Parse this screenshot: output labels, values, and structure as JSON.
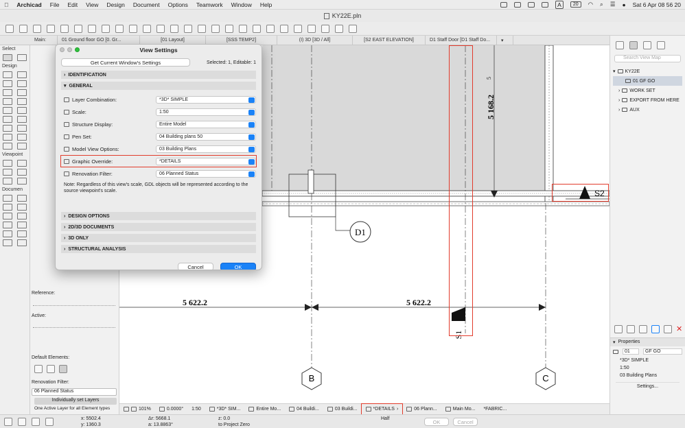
{
  "menubar": {
    "app": "Archicad",
    "items": [
      "File",
      "Edit",
      "View",
      "Design",
      "Document",
      "Options",
      "Teamwork",
      "Window",
      "Help"
    ],
    "status_letter": "A",
    "battery": "20",
    "datetime": "Sat 6 Apr  08 56 20"
  },
  "window": {
    "title": "KY22E.pln"
  },
  "tabs": {
    "main_label": "Main:",
    "items": [
      "01 Ground floor GO [0. Gr...",
      "[01 Layout]",
      "[SSS TEMP2]",
      "(I) 3D [3D / All]",
      "[S2 EAST ELEVATION]",
      "D1 Staff Door [D1 Staff Do..."
    ]
  },
  "toolbox": {
    "select": "Select",
    "design": "Design",
    "viewpoint": "Viewpoint",
    "document": "Documen"
  },
  "infobox": {
    "reference": "Reference:",
    "active": "Active:",
    "default_elements": "Default Elements:",
    "renovation_filter": "Renovation Filter:",
    "renovation_value": "06 Planned Status",
    "individually": "Individually set Layers",
    "one_active": "One Active Layer for all Element types"
  },
  "dialog": {
    "title": "View Settings",
    "get_current": "Get Current Window's Settings",
    "selected": "Selected: 1, Editable: 1",
    "identification": "IDENTIFICATION",
    "general": "GENERAL",
    "rows": [
      {
        "label": "Layer Combination:",
        "value": "*3D* SIMPLE"
      },
      {
        "label": "Scale:",
        "value": "1:50"
      },
      {
        "label": "Structure Display:",
        "value": "Entire Model"
      },
      {
        "label": "Pen Set:",
        "value": "04 Building plans 50"
      },
      {
        "label": "Model View Options:",
        "value": "03 Building Plans"
      },
      {
        "label": "Graphic Override:",
        "value": "*DETAILS"
      },
      {
        "label": "Renovation Filter:",
        "value": "06 Planned Status"
      }
    ],
    "note": "Note: Regardless of this view's scale, GDL objects will be represented according to the source viewpoint's scale.",
    "sections": [
      "DESIGN OPTIONS",
      "2D/3D DOCUMENTS",
      "3D ONLY",
      "STRUCTURAL ANALYSIS"
    ],
    "cancel": "Cancel",
    "ok": "OK"
  },
  "drawing": {
    "dim_vertical": "5 168.2",
    "dim_vertical_sup": "5",
    "dim_left": "5 622.2",
    "dim_right": "5 622.2",
    "marker_d1": "D1",
    "marker_s1": "S1",
    "marker_s2": "S2",
    "grid_b": "B",
    "grid_c": "C"
  },
  "navigator": {
    "search_placeholder": "Search View Map",
    "root": "KY22E",
    "selected_item": "01 GF GO",
    "folders": [
      "WORK SET",
      "EXPORT FROM HERE",
      "AUX"
    ]
  },
  "properties": {
    "title": "Properties",
    "id": "01",
    "name": "GF GO",
    "layer": "*3D* SIMPLE",
    "scale": "1:50",
    "mvo": "03 Building Plans",
    "settings": "Settings..."
  },
  "quickbar": {
    "zoom": "101%",
    "angle": "0.0000°",
    "scale": "1:50",
    "layer": "*3D* SIM...",
    "structure": "Entire Mo...",
    "penset": "04 Buildi...",
    "mvo": "03 Buildi...",
    "override": "*DETAILS",
    "renovation": "06 Plann...",
    "main_model": "Main Mo...",
    "fabric": "*FABRIC..."
  },
  "coords": {
    "x": "x: 5502.4",
    "y": "y: 1360.3",
    "dr": "Δr: 5668.1",
    "a": "a: 13.8863°",
    "z": "z: 0.0",
    "zero": "to Project Zero",
    "half": "Half",
    "ok": "OK",
    "cancel": "Cancel"
  },
  "colors": {
    "accent": "#1a82f7",
    "highlight": "#e23b2b"
  }
}
